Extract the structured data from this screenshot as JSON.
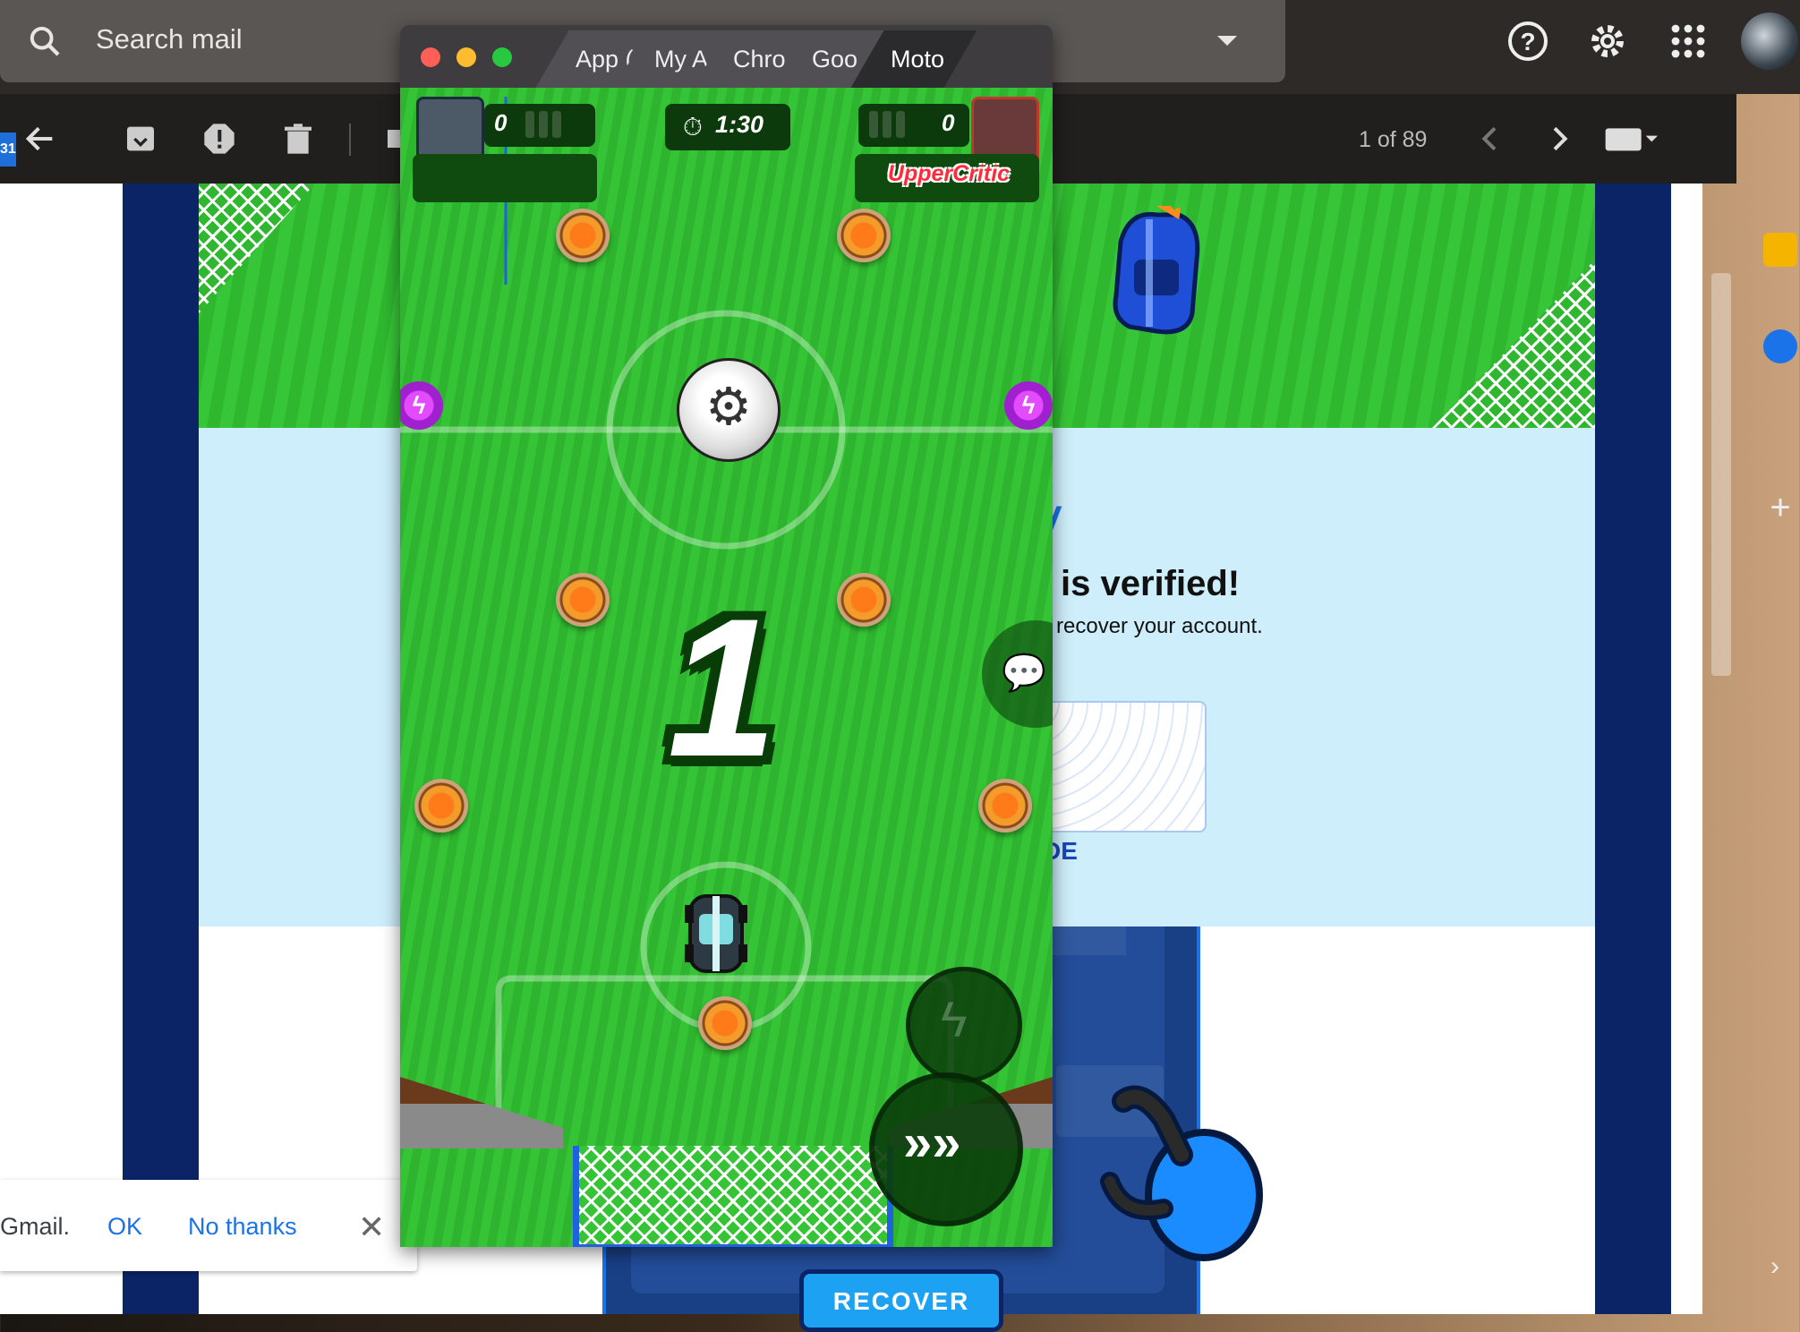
{
  "gmail": {
    "search_placeholder": "Search mail",
    "pager": "1 of 89",
    "calendar_badge": "31",
    "add_label": "+",
    "chevron": "›",
    "email": {
      "headline": "is verified!",
      "subline": "recover your account.",
      "code_link": "DE",
      "accent_fragment": "/",
      "recover_button": "RECOVER"
    },
    "snackbar": {
      "text": "Gmail.",
      "ok": "OK",
      "no_thanks": "No thanks",
      "close": "✕"
    }
  },
  "game_window": {
    "tabs": [
      "App (",
      "My A",
      "Chro",
      "Goo",
      "Moto"
    ],
    "active_tab_index": 4,
    "hud": {
      "player1_score": "0",
      "timer": "1:30",
      "player2_score": "0",
      "player2_name": "UpperCritic"
    },
    "countdown": "1",
    "dash_label": "»»",
    "boost_label": "ϟ",
    "bolt_label": "ϟ"
  },
  "colors": {
    "gmail_dark": "#2d2a28",
    "field_green": "#35c435",
    "email_navy": "#0b2466",
    "panel_light_blue": "#cdeefa",
    "accent_blue": "#1a73e8",
    "opponent_red": "#ff2a3a"
  },
  "icons": [
    "search-icon",
    "help-icon",
    "gear-icon",
    "apps-icon",
    "back-icon",
    "archive-icon",
    "spam-icon",
    "trash-icon",
    "label-icon",
    "prev-icon",
    "next-icon",
    "keyboard-icon",
    "calendar-icon",
    "keep-icon",
    "tasks-icon",
    "add-icon",
    "chat-icon",
    "boost-icon",
    "dash-icon",
    "timer-icon",
    "close-icon"
  ]
}
